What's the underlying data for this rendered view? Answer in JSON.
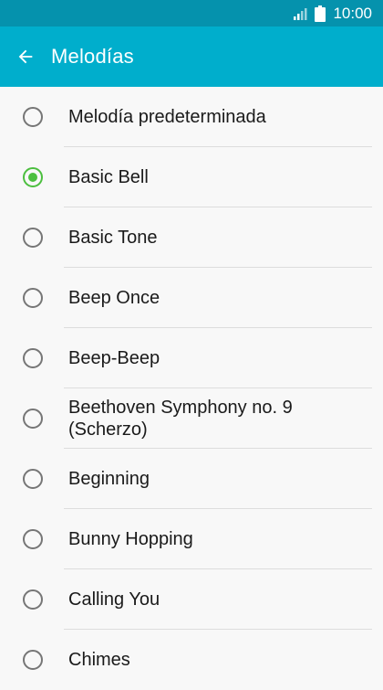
{
  "status_bar": {
    "time": "10:00",
    "signal_icon": "signal-icon",
    "battery_icon": "battery-icon"
  },
  "app_bar": {
    "back_icon": "arrow-left-icon",
    "title": "Melodías"
  },
  "ringtones": [
    {
      "label": "Melodía predeterminada",
      "selected": false
    },
    {
      "label": "Basic Bell",
      "selected": true
    },
    {
      "label": "Basic Tone",
      "selected": false
    },
    {
      "label": "Beep Once",
      "selected": false
    },
    {
      "label": "Beep-Beep",
      "selected": false
    },
    {
      "label": "Beethoven Symphony no. 9 (Scherzo)",
      "selected": false
    },
    {
      "label": "Beginning",
      "selected": false
    },
    {
      "label": "Bunny Hopping",
      "selected": false
    },
    {
      "label": "Calling You",
      "selected": false
    },
    {
      "label": "Chimes",
      "selected": false
    }
  ],
  "colors": {
    "app_bar": "#00aecc",
    "status_bar": "#0592ad",
    "radio_selected": "#4cbf3f"
  }
}
